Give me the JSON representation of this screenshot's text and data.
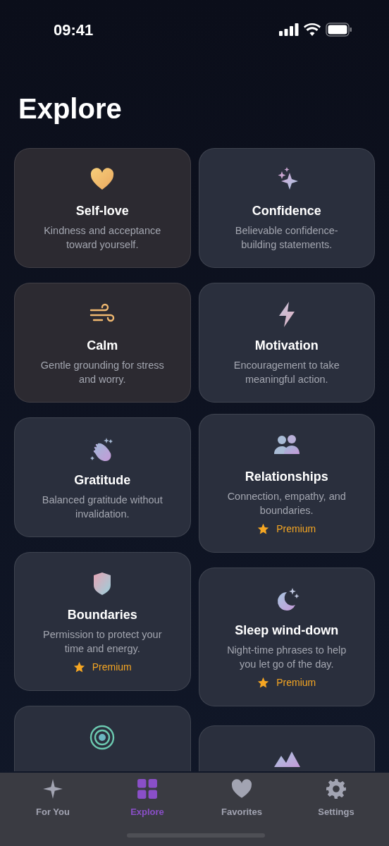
{
  "status_bar": {
    "time": "09:41"
  },
  "title": "Explore",
  "columns": [
    [
      {
        "title": "Self-love",
        "description": "Kindness and acceptance toward yourself."
      },
      {
        "title": "Calm",
        "description": "Gentle grounding for stress and worry."
      },
      {
        "title": "Gratitude",
        "description": "Balanced gratitude without invalidation."
      },
      {
        "title": "Boundaries",
        "description": "Permission to protect your time and energy.",
        "badge": "Premium"
      },
      {}
    ],
    [
      {
        "title": "Confidence",
        "description": "Believable confidence-building statements."
      },
      {
        "title": "Motivation",
        "description": "Encouragement to take meaningful action."
      },
      {
        "title": "Relationships",
        "description": "Connection, empathy, and boundaries.",
        "badge": "Premium"
      },
      {
        "title": "Sleep wind-down",
        "description": "Night-time phrases to help you let go of the day.",
        "badge": "Premium"
      },
      {}
    ]
  ],
  "tabs": [
    {
      "label": "For You",
      "selected": false
    },
    {
      "label": "Explore",
      "selected": true
    },
    {
      "label": "Favorites",
      "selected": false
    },
    {
      "label": "Settings",
      "selected": false
    }
  ]
}
